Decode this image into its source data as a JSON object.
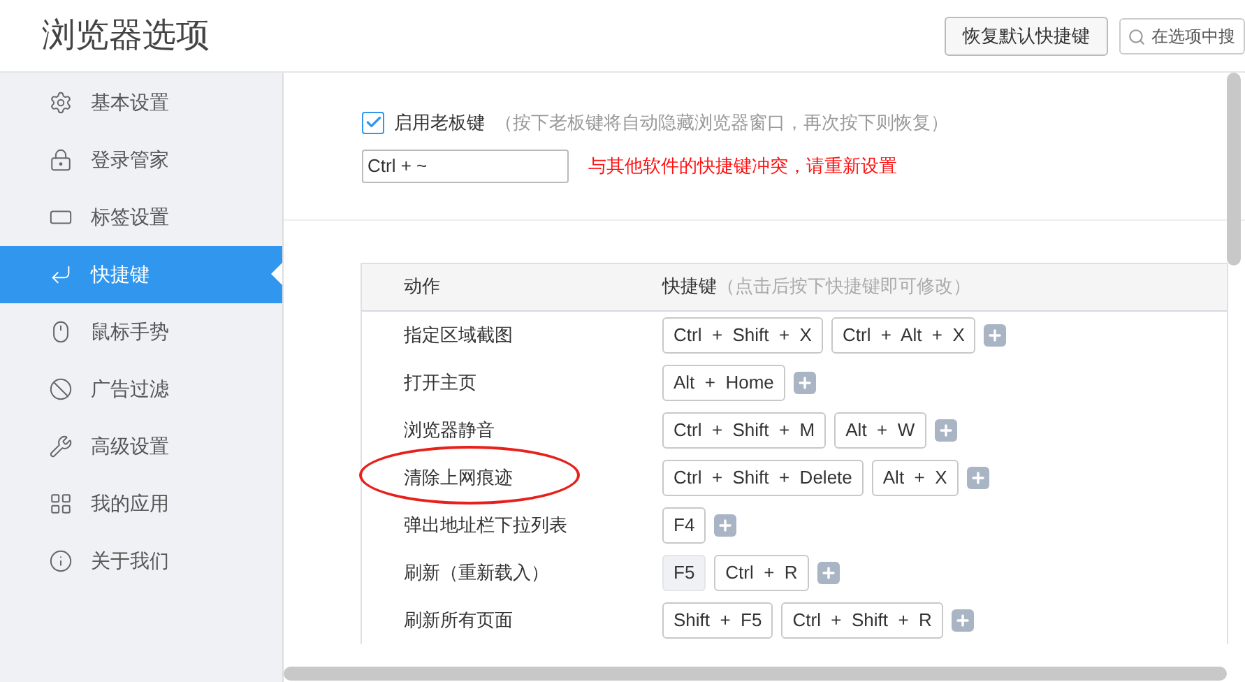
{
  "window": {
    "title": "浏览器选项"
  },
  "header": {
    "reset_button": "恢复默认快捷键",
    "search": {
      "placeholder": "在选项中搜"
    }
  },
  "sidebar": {
    "items": [
      {
        "label": "基本设置",
        "selected": false
      },
      {
        "label": "登录管家",
        "selected": false
      },
      {
        "label": "标签设置",
        "selected": false
      },
      {
        "label": "快捷键",
        "selected": true
      },
      {
        "label": "鼠标手势",
        "selected": false
      },
      {
        "label": "广告过滤",
        "selected": false
      },
      {
        "label": "高级设置",
        "selected": false
      },
      {
        "label": "我的应用",
        "selected": false
      },
      {
        "label": "关于我们",
        "selected": false
      }
    ]
  },
  "boss_key": {
    "checked": true,
    "label": "启用老板键",
    "hint": "（按下老板键将自动隐藏浏览器窗口，再次按下则恢复）",
    "value": "Ctrl + ~",
    "error": "与其他软件的快捷键冲突，请重新设置"
  },
  "table": {
    "columns": [
      "动作",
      "快捷键"
    ],
    "column_hint": "（点击后按下快捷键即可修改）",
    "rows": [
      {
        "action": "指定区域截图",
        "circled": false,
        "keys": [
          {
            "text": "Ctrl  +  Shift  +  X",
            "fixed": false
          },
          {
            "text": "Ctrl  +  Alt  +  X",
            "fixed": false
          }
        ]
      },
      {
        "action": "打开主页",
        "circled": false,
        "keys": [
          {
            "text": "Alt  +  Home",
            "fixed": false
          }
        ]
      },
      {
        "action": "浏览器静音",
        "circled": false,
        "keys": [
          {
            "text": "Ctrl  +  Shift  +  M",
            "fixed": false
          },
          {
            "text": "Alt  +  W",
            "fixed": false
          }
        ]
      },
      {
        "action": "清除上网痕迹",
        "circled": true,
        "keys": [
          {
            "text": "Ctrl  +  Shift  +  Delete",
            "fixed": false
          },
          {
            "text": "Alt  +  X",
            "fixed": false
          }
        ]
      },
      {
        "action": "弹出地址栏下拉列表",
        "circled": false,
        "keys": [
          {
            "text": "F4",
            "fixed": false
          }
        ]
      },
      {
        "action": "刷新（重新载入）",
        "circled": false,
        "keys": [
          {
            "text": "F5",
            "fixed": true
          },
          {
            "text": "Ctrl  +  R",
            "fixed": false
          }
        ]
      },
      {
        "action": "刷新所有页面",
        "circled": false,
        "keys": [
          {
            "text": "Shift  +  F5",
            "fixed": false
          },
          {
            "text": "Ctrl  +  Shift  +  R",
            "fixed": false
          }
        ]
      }
    ]
  }
}
